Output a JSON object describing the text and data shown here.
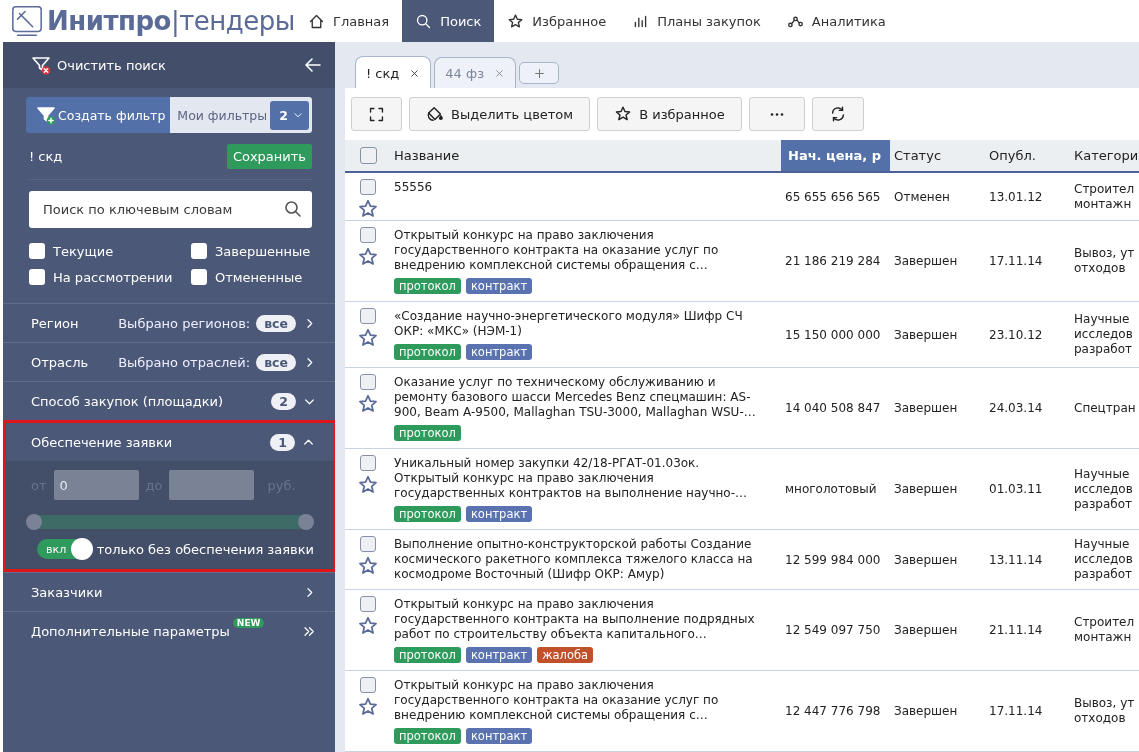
{
  "header": {
    "logo": "**Инитпро**|тендеры",
    "nav": [
      {
        "label": "Главная",
        "kind": "home",
        "selected": false
      },
      {
        "label": "Поиск",
        "kind": "search",
        "selected": true
      },
      {
        "label": "Избранное",
        "kind": "favorites",
        "selected": false
      },
      {
        "label": "Планы закупок",
        "kind": "plans",
        "selected": false
      },
      {
        "label": "Аналитика",
        "kind": "analytics",
        "selected": false
      }
    ]
  },
  "sidebar": {
    "clear_label": "Очистить поиск",
    "create_filter": "Создать фильтр",
    "my_filters": "Мои фильтры",
    "my_filters_count": "2",
    "filter_name": "! скд",
    "save": "Сохранить",
    "search": {
      "placeholder": "Поиск по ключевым словам"
    },
    "statuses": [
      {
        "label": "Текущие",
        "checked": false
      },
      {
        "label": "Завершенные",
        "checked": false
      },
      {
        "label": "На рассмотрении",
        "checked": false
      },
      {
        "label": "Отмененные",
        "checked": false
      }
    ],
    "sections": [
      {
        "kind": "link",
        "label": "Регион",
        "summary": "Выбрано регионов:",
        "badge": "все"
      },
      {
        "kind": "link",
        "label": "Отрасль",
        "summary": "Выбрано отраслей:",
        "badge": "все"
      },
      {
        "kind": "collapsible",
        "label": "Способ закупок (площадки)",
        "badge": "2",
        "expanded": false,
        "highlighted": false
      },
      {
        "kind": "collapsible",
        "label": "Обеспечение заявки",
        "badge": "1",
        "expanded": true,
        "highlighted": true,
        "range": {
          "from_label": "от",
          "from_value": "0",
          "to_label": "до",
          "unit": "руб.",
          "thumbs": [
            {
              "level": 0
            },
            {
              "level": 1
            }
          ]
        },
        "toggle": {
          "label": "вкл",
          "on": true,
          "text": "только без обеспечения заявки"
        }
      },
      {
        "kind": "link",
        "label": "Заказчики"
      },
      {
        "kind": "more",
        "label": "Дополнительные параметры",
        "new_badge": "NEW"
      }
    ]
  },
  "tabs": [
    {
      "label": "! скд",
      "selected": true
    },
    {
      "label": "44 фз",
      "selected": false
    }
  ],
  "toolbar": [
    {
      "kind": "fullscreen"
    },
    {
      "kind": "color",
      "label": "Выделить цветом"
    },
    {
      "kind": "favorite",
      "label": "В избранное"
    },
    {
      "kind": "more"
    },
    {
      "kind": "refresh"
    }
  ],
  "table": {
    "select_all_checked": false,
    "columns": [
      {
        "label": "Название",
        "sorted": false
      },
      {
        "label": "Нач. цена, р",
        "sorted": true
      },
      {
        "label": "Статус",
        "sorted": false
      },
      {
        "label": "Опубл.",
        "sorted": false
      },
      {
        "label": "Категори",
        "sorted": false
      }
    ],
    "rows": [
      {
        "checked": false,
        "starred": false,
        "title": "55556",
        "tags": [],
        "price": "65 655 656 565",
        "status": "Отменен",
        "date": "13.01.12",
        "category": "Строител\nмонтажн"
      },
      {
        "checked": false,
        "starred": false,
        "title": "Открытый конкурс на право заключения\nгосударственного контракта на оказание услуг по\nвнедрению комплексной системы обращения с…",
        "tags": [
          {
            "label": "протокол",
            "color": "#2e9a5b"
          },
          {
            "label": "контракт",
            "color": "#5a73b0"
          }
        ],
        "price": "21 186 219 284",
        "status": "Завершен",
        "date": "17.11.14",
        "category": "Вывоз, ут\nотходов"
      },
      {
        "checked": false,
        "starred": false,
        "title": "«Создание научно-энергетического модуля» Шифр СЧ\nОКР: «МКС» (НЭМ-1)",
        "tags": [
          {
            "label": "протокол",
            "color": "#2e9a5b"
          },
          {
            "label": "контракт",
            "color": "#5a73b0"
          }
        ],
        "price": "15 150 000 000",
        "status": "Завершен",
        "date": "23.10.12",
        "category": "Научные\nисследов\nразработ"
      },
      {
        "checked": false,
        "starred": false,
        "title": "Оказание услуг по техническому обслуживанию и\nремонту базового шасси Mercedes Benz спецмашин: AS-\n900, Beam A-9500, Mallaghan TSU-3000, Mallaghan WSU-…",
        "tags": [
          {
            "label": "протокол",
            "color": "#2e9a5b"
          }
        ],
        "price": "14 040 508 847",
        "status": "Завершен",
        "date": "24.03.14",
        "category": "Спецтран"
      },
      {
        "checked": false,
        "starred": false,
        "title": "Уникальный номер закупки 42/18-РГАТ-01.03ок.\nОткрытый конкурс на право заключения\nгосударственных контрактов на выполнение научно-…",
        "tags": [
          {
            "label": "протокол",
            "color": "#2e9a5b"
          },
          {
            "label": "контракт",
            "color": "#5a73b0"
          }
        ],
        "price": "многолотовый",
        "status": "Завершен",
        "date": "01.03.11",
        "category": "Научные\nисследов\nразработ"
      },
      {
        "checked": false,
        "starred": false,
        "title": "Выполнение опытно-конструкторской работы Создание\nкосмического ракетного комплекса тяжелого класса на\nкосмодроме Восточный (Шифр ОКР: Амур)",
        "tags": [],
        "price": "12 599 984 000",
        "status": "Завершен",
        "date": "13.11.14",
        "category": "Научные\nисследов\nразработ"
      },
      {
        "checked": false,
        "starred": false,
        "title": "Открытый конкурс на право заключения\nгосударственного контракта на выполнение подрядных\nработ по строительству объекта капитального…",
        "tags": [
          {
            "label": "протокол",
            "color": "#2e9a5b"
          },
          {
            "label": "контракт",
            "color": "#5a73b0"
          },
          {
            "label": "жалоба",
            "color": "#c0512a"
          }
        ],
        "price": "12 549 097 750",
        "status": "Завершен",
        "date": "21.11.14",
        "category": "Строител\nмонтажн"
      },
      {
        "checked": false,
        "starred": false,
        "title": "Открытый конкурс на право заключения\nгосударственного контракта на оказание услуг по\nвнедрению комплексной системы обращения с…",
        "tags": [
          {
            "label": "протокол",
            "color": "#2e9a5b"
          },
          {
            "label": "контракт",
            "color": "#5a73b0"
          }
        ],
        "price": "12 447 776 798",
        "status": "Завершен",
        "date": "17.11.14",
        "category": "Вывоз, ут\nотходов"
      }
    ]
  }
}
